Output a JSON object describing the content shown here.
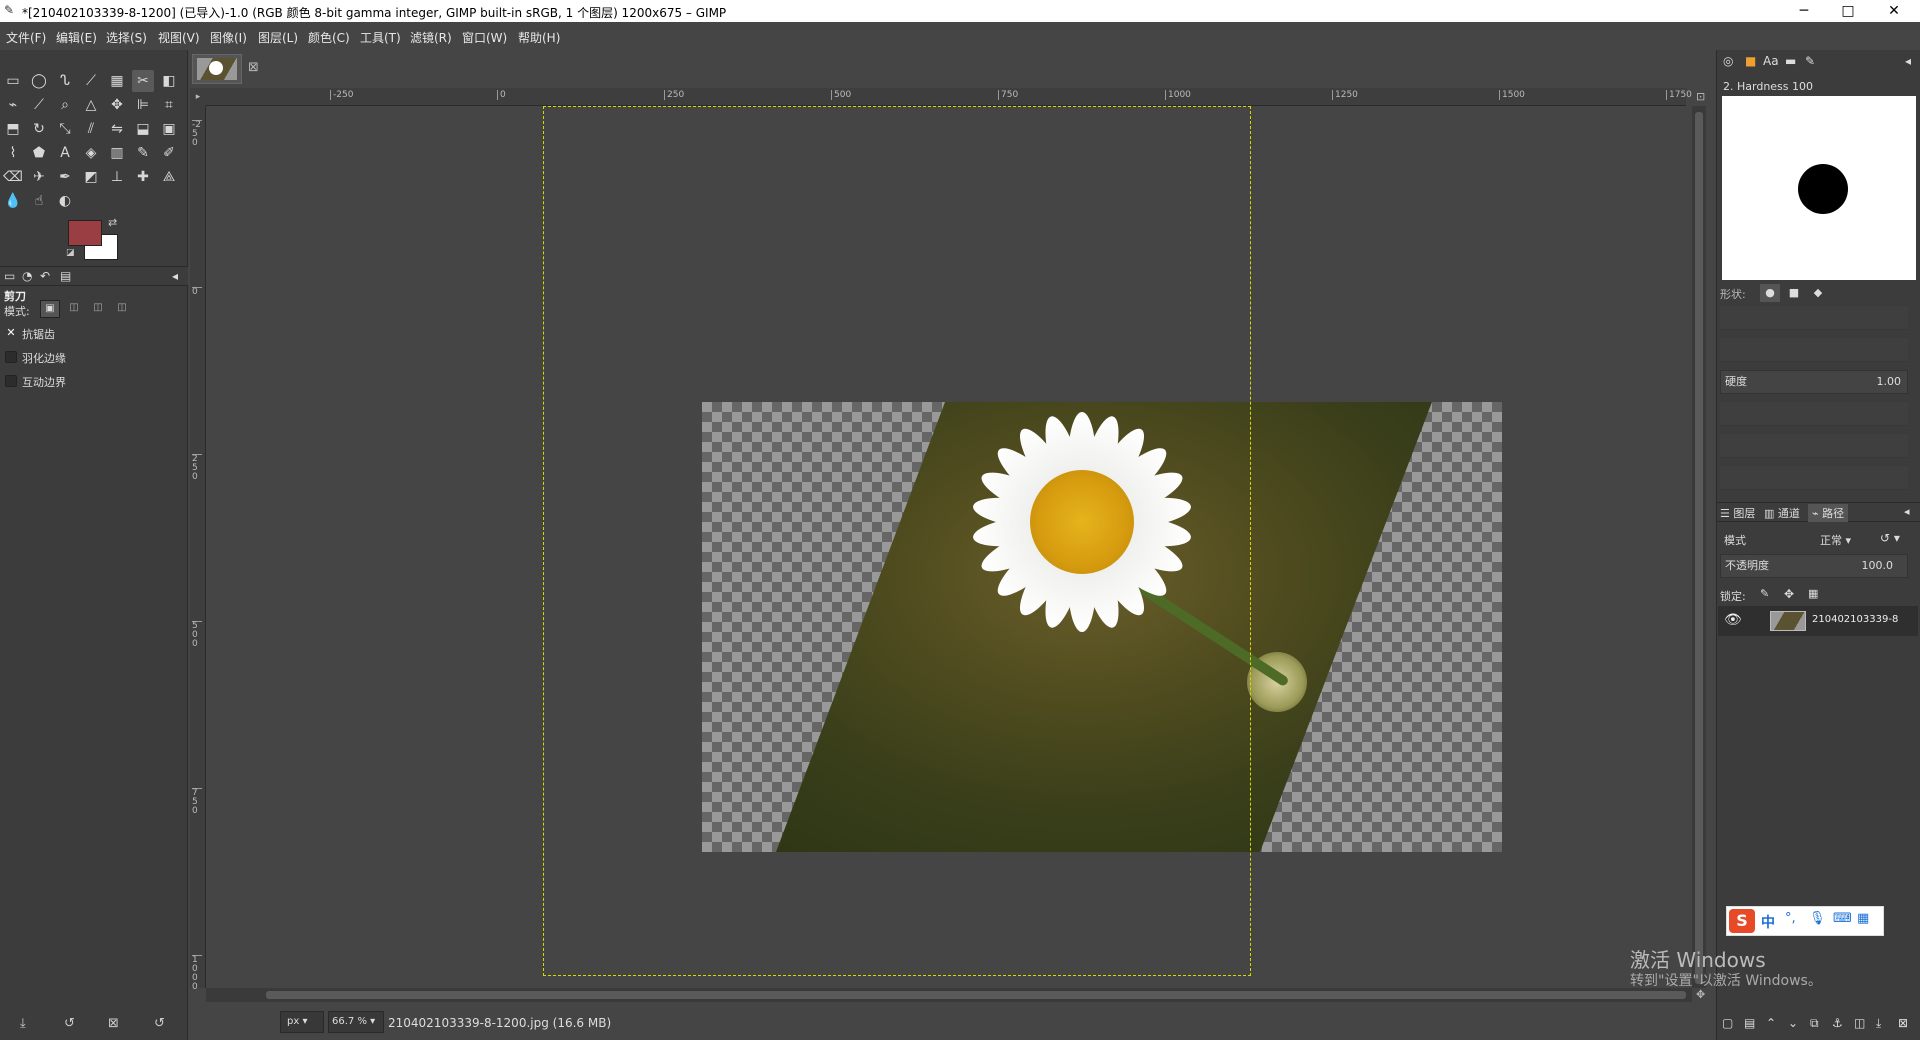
{
  "window": {
    "title": "*[210402103339-8-1200] (已导入)-1.0 (RGB 颜色 8-bit gamma integer, GIMP built-in sRGB, 1 个图层) 1200x675 – GIMP",
    "minimize": "─",
    "maximize": "□",
    "close": "✕"
  },
  "menu": [
    "文件(F)",
    "编辑(E)",
    "选择(S)",
    "视图(V)",
    "图像(I)",
    "图层(L)",
    "颜色(C)",
    "工具(T)",
    "滤镜(R)",
    "窗口(W)",
    "帮助(H)"
  ],
  "toolbox": {
    "tools": [
      {
        "name": "rect-select",
        "glyph": "▭"
      },
      {
        "name": "ellipse-select",
        "glyph": "◯"
      },
      {
        "name": "free-select",
        "glyph": "ᔐ"
      },
      {
        "name": "fuzzy-select",
        "glyph": "⟋"
      },
      {
        "name": "select-by-color",
        "glyph": "▦"
      },
      {
        "name": "scissors-select",
        "glyph": "✂"
      },
      {
        "name": "foreground-select",
        "glyph": "◧"
      },
      {
        "name": "paths",
        "glyph": "⌁"
      },
      {
        "name": "color-picker",
        "glyph": "⟋"
      },
      {
        "name": "zoom",
        "glyph": "⌕"
      },
      {
        "name": "measure",
        "glyph": "△"
      },
      {
        "name": "move",
        "glyph": "✥"
      },
      {
        "name": "align",
        "glyph": "⊫"
      },
      {
        "name": "crop",
        "glyph": "⌗"
      },
      {
        "name": "unified-transform",
        "glyph": "⬒"
      },
      {
        "name": "rotate",
        "glyph": "↻"
      },
      {
        "name": "scale",
        "glyph": "⤡"
      },
      {
        "name": "shear",
        "glyph": "⫽"
      },
      {
        "name": "flip",
        "glyph": "⇋"
      },
      {
        "name": "perspective",
        "glyph": "⬓"
      },
      {
        "name": "3d-transform",
        "glyph": "▣"
      },
      {
        "name": "warp-transform",
        "glyph": "⌇"
      },
      {
        "name": "cage-transform",
        "glyph": "⬟"
      },
      {
        "name": "text",
        "glyph": "A"
      },
      {
        "name": "bucket-fill",
        "glyph": "◈"
      },
      {
        "name": "gradient",
        "glyph": "▥"
      },
      {
        "name": "pencil",
        "glyph": "✎"
      },
      {
        "name": "paintbrush",
        "glyph": "✐"
      },
      {
        "name": "eraser",
        "glyph": "⌫"
      },
      {
        "name": "airbrush",
        "glyph": "✈"
      },
      {
        "name": "ink",
        "glyph": "✒"
      },
      {
        "name": "mypaint-brush",
        "glyph": "◩"
      },
      {
        "name": "clone",
        "glyph": "⊥"
      },
      {
        "name": "heal",
        "glyph": "✚"
      },
      {
        "name": "perspective-clone",
        "glyph": "⟁"
      },
      {
        "name": "blur-sharpen",
        "glyph": "💧"
      },
      {
        "name": "smudge",
        "glyph": "☝"
      },
      {
        "name": "dodge-burn",
        "glyph": "◐"
      }
    ],
    "tool_options_title": "剪刀",
    "mode_label": "模式:",
    "option_antialias": "抗锯齿",
    "option_feather": "羽化边缘",
    "option_interactive": "互动边界"
  },
  "image_tab": {
    "close": "⊠"
  },
  "rulers": {
    "top": [
      "-250",
      "0",
      "250",
      "500",
      "750",
      "1000",
      "1250",
      "1500",
      "1750"
    ],
    "left": [
      "-250",
      "0",
      "250",
      "500",
      "750",
      "1000"
    ]
  },
  "status": {
    "unit": "px",
    "zoom": "66.7 %",
    "file": "210402103339-8-1200.jpg (16.6 MB)"
  },
  "dock": {
    "brush_name": "2. Hardness 100",
    "shape_label": "形状:",
    "hardness_label": "硬度",
    "hardness_value": "1.00",
    "layers_tab": "图层",
    "channels_tab": "通道",
    "paths_tab": "路径",
    "mode_label": "模式",
    "mode_value": "正常",
    "opacity_label": "不透明度",
    "opacity_value": "100.0",
    "lock_label": "锁定:",
    "layer_name": "210402103339-8"
  },
  "watermark": {
    "line1": "激活 Windows",
    "line2": "转到\"设置\"以激活 Windows。"
  },
  "ime": {
    "label": "中"
  }
}
